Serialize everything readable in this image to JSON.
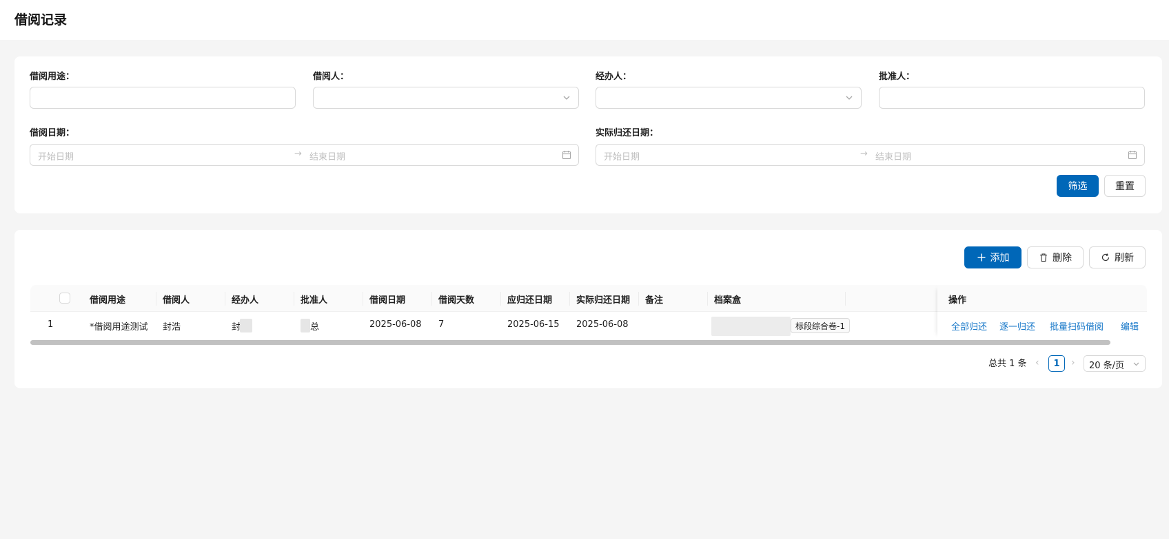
{
  "header": {
    "title": "借阅记录"
  },
  "filters": {
    "purpose_label": "借阅用途：",
    "borrower_label": "借阅人：",
    "handler_label": "经办人：",
    "approver_label": "批准人：",
    "borrow_date_label": "借阅日期：",
    "return_date_label": "实际归还日期：",
    "start_placeholder": "开始日期",
    "end_placeholder": "结束日期",
    "range_arrow": "→",
    "filter_button": "筛选",
    "reset_button": "重置"
  },
  "toolbar": {
    "add_label": "添加",
    "delete_label": "删除",
    "refresh_label": "刷新"
  },
  "table": {
    "columns": [
      "借阅用途",
      "借阅人",
      "经办人",
      "批准人",
      "借阅日期",
      "借阅天数",
      "应归还日期",
      "实际归还日期",
      "备注",
      "档案盒",
      "操作"
    ],
    "rows": [
      {
        "index": "1",
        "purpose": "*借阅用途测试",
        "borrower": "封浩",
        "handler": "封",
        "approver": "总",
        "borrow_date": "2025-06-08",
        "days": "7",
        "due_date": "2025-06-15",
        "return_date": "2025-06-08",
        "remark": "",
        "box_tag": "标段综合卷-1",
        "actions": [
          "全部归还",
          "逐一归还",
          "批量扫码借阅",
          "编辑"
        ]
      }
    ]
  },
  "pagination": {
    "total_text": "总共 1 条",
    "current_page": "1",
    "page_size": "20 条/页"
  },
  "colors": {
    "primary": "#0067b8",
    "link": "#1677c8"
  }
}
